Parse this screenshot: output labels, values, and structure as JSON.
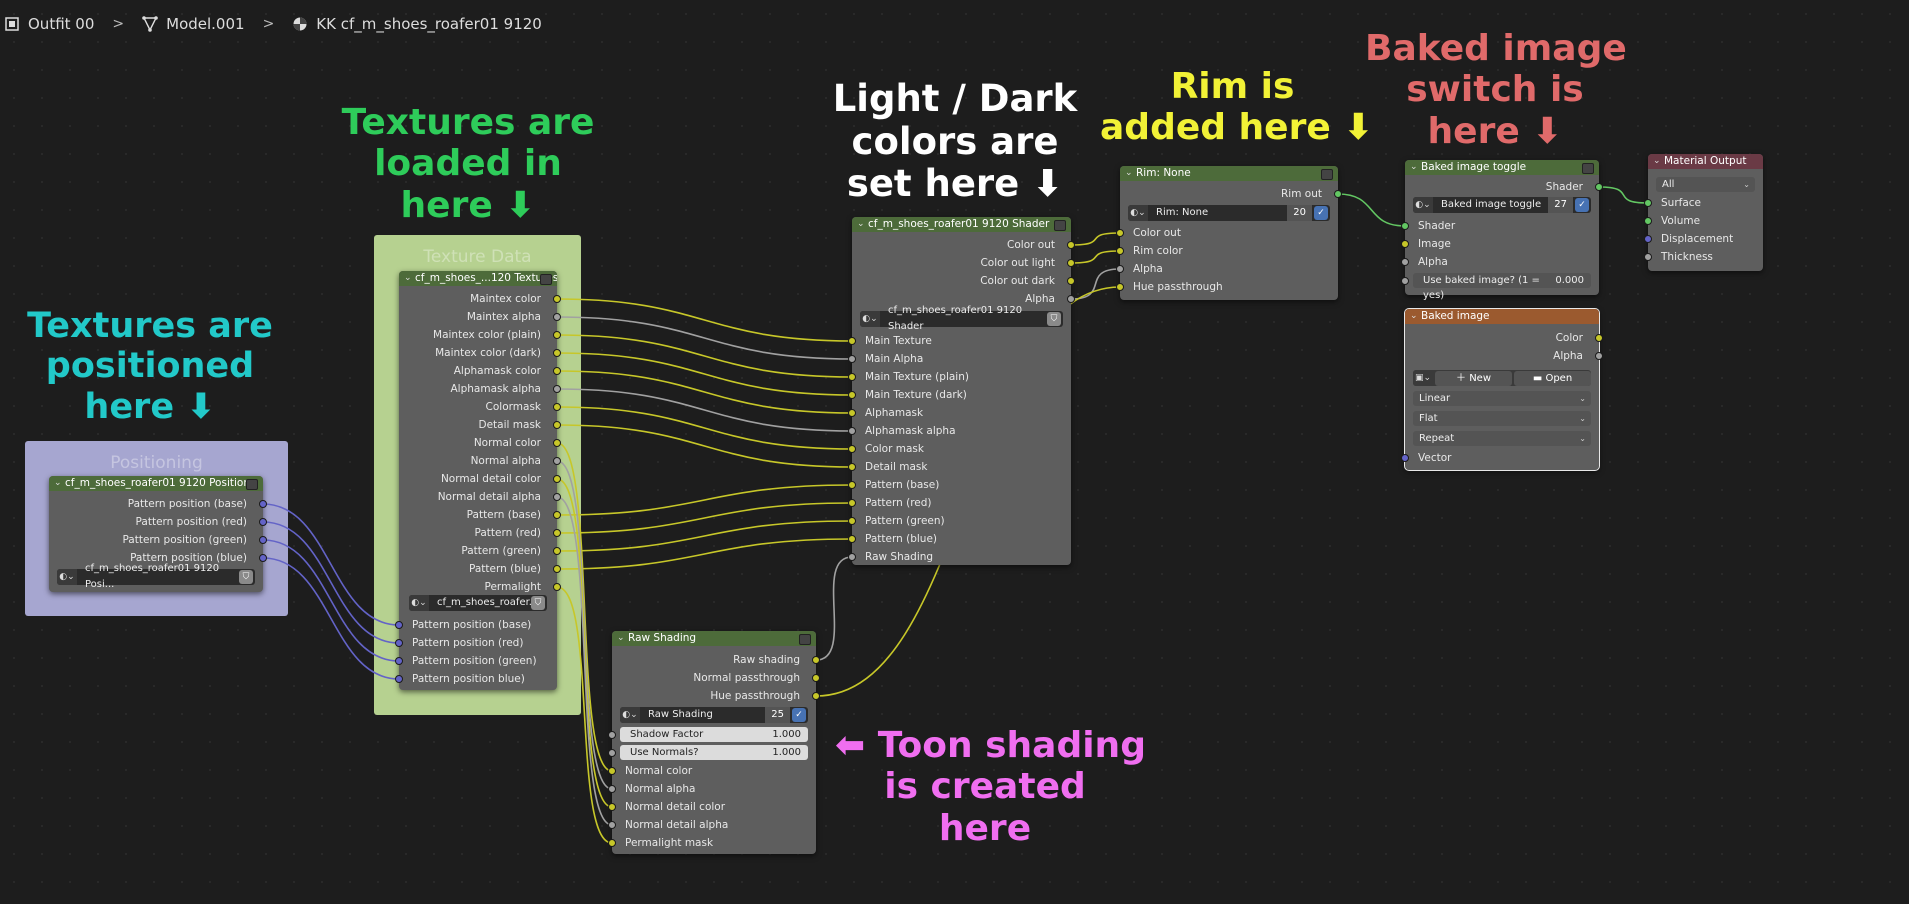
{
  "breadcrumb": {
    "items": [
      {
        "label": "Outfit 00",
        "icon": "object-icon"
      },
      {
        "label": "Model.001",
        "icon": "mesh-data-icon"
      },
      {
        "label": "KK cf_m_shoes_roafer01 9120",
        "icon": "material-icon"
      }
    ]
  },
  "frames": {
    "positioning": "Positioning",
    "textures": "Texture Data"
  },
  "nodes": {
    "position": {
      "title": "cf_m_shoes_roafer01 9120 Position",
      "outputs": [
        "Pattern position (base)",
        "Pattern position (red)",
        "Pattern position (green)",
        "Pattern position (blue)"
      ],
      "group": "cf_m_shoes_roafer01 9120 Posi..."
    },
    "textures": {
      "title": "cf_m_shoes_...120 Textures",
      "outputs": [
        "Maintex color",
        "Maintex alpha",
        "Maintex color (plain)",
        "Maintex color (dark)",
        "Alphamask color",
        "Alphamask alpha",
        "Colormask",
        "Detail mask",
        "Normal color",
        "Normal alpha",
        "Normal detail color",
        "Normal detail alpha",
        "Pattern (base)",
        "Pattern (red)",
        "Pattern (green)",
        "Pattern (blue)",
        "Permalight"
      ],
      "group": "cf_m_shoes_roafer...",
      "inputs": [
        "Pattern position (base)",
        "Pattern position (red)",
        "Pattern position (green)",
        "Pattern position blue)"
      ]
    },
    "shader": {
      "title": "cf_m_shoes_roafer01 9120 Shader",
      "outputs": [
        "Color out",
        "Color out light",
        "Color out dark",
        "Alpha"
      ],
      "group": "cf_m_shoes_roafer01 9120 Shader",
      "inputs": [
        "Main Texture",
        "Main Alpha",
        "Main Texture (plain)",
        "Main Texture (dark)",
        "Alphamask",
        "Alphamask alpha",
        "Color mask",
        "Detail mask",
        "Pattern (base)",
        "Pattern (red)",
        "Pattern (green)",
        "Pattern (blue)",
        "Raw Shading"
      ]
    },
    "raw": {
      "title": "Raw Shading",
      "outputs": [
        "Raw shading",
        "Normal passthrough",
        "Hue passthrough"
      ],
      "group": "Raw Shading",
      "group_users": "25",
      "fields": [
        {
          "label": "Shadow Factor",
          "value": "1.000"
        },
        {
          "label": "Use Normals?",
          "value": "1.000"
        }
      ],
      "inputs": [
        "Normal color",
        "Normal alpha",
        "Normal detail color",
        "Normal detail alpha",
        "Permalight mask"
      ]
    },
    "rim": {
      "title": "Rim: None",
      "output": "Rim out",
      "group": "Rim: None",
      "group_users": "20",
      "inputs": [
        "Color out",
        "Rim color",
        "Alpha",
        "Hue passthrough"
      ]
    },
    "toggle": {
      "title": "Baked image toggle",
      "output": "Shader",
      "group": "Baked image toggle",
      "group_users": "27",
      "inputs": [
        "Shader",
        "Image",
        "Alpha"
      ],
      "field": {
        "label": "Use baked image? (1 = yes)",
        "value": "0.000"
      }
    },
    "baked": {
      "title": "Baked image",
      "outputs": [
        "Color",
        "Alpha"
      ],
      "new_label": "New",
      "open_label": "Open",
      "interpolation": "Linear",
      "projection": "Flat",
      "extension": "Repeat",
      "input": "Vector"
    },
    "output": {
      "title": "Material Output",
      "target": "All",
      "inputs": [
        "Surface",
        "Volume",
        "Displacement",
        "Thickness"
      ]
    }
  },
  "annotations": [
    {
      "id": "pos",
      "text": "Textures are\npositioned\nhere ⬇",
      "color": "#22c9c9"
    },
    {
      "id": "tex",
      "text": "Textures are\nloaded in\nhere ⬇",
      "color": "#2ecc5a"
    },
    {
      "id": "ld",
      "text": "Light / Dark\ncolors are\nset here ⬇",
      "color": "#ffffff"
    },
    {
      "id": "rim",
      "text": "Rim is\nadded here ⬇",
      "color": "#f2f236"
    },
    {
      "id": "baked",
      "text": "Baked image\nswitch is\nhere ⬇",
      "color": "#e06a6a"
    },
    {
      "id": "toon",
      "text": "⬅ Toon shading\nis created\nhere",
      "color": "#f06ef0"
    }
  ],
  "colors": {
    "socket_color": "#c7c729",
    "socket_float": "#a1a1a1",
    "socket_vector": "#6363c7",
    "socket_shader": "#63c763",
    "group_header": "#4d6b3a",
    "output_header": "#6a3a45",
    "texture_header": "#9b5a2f"
  }
}
